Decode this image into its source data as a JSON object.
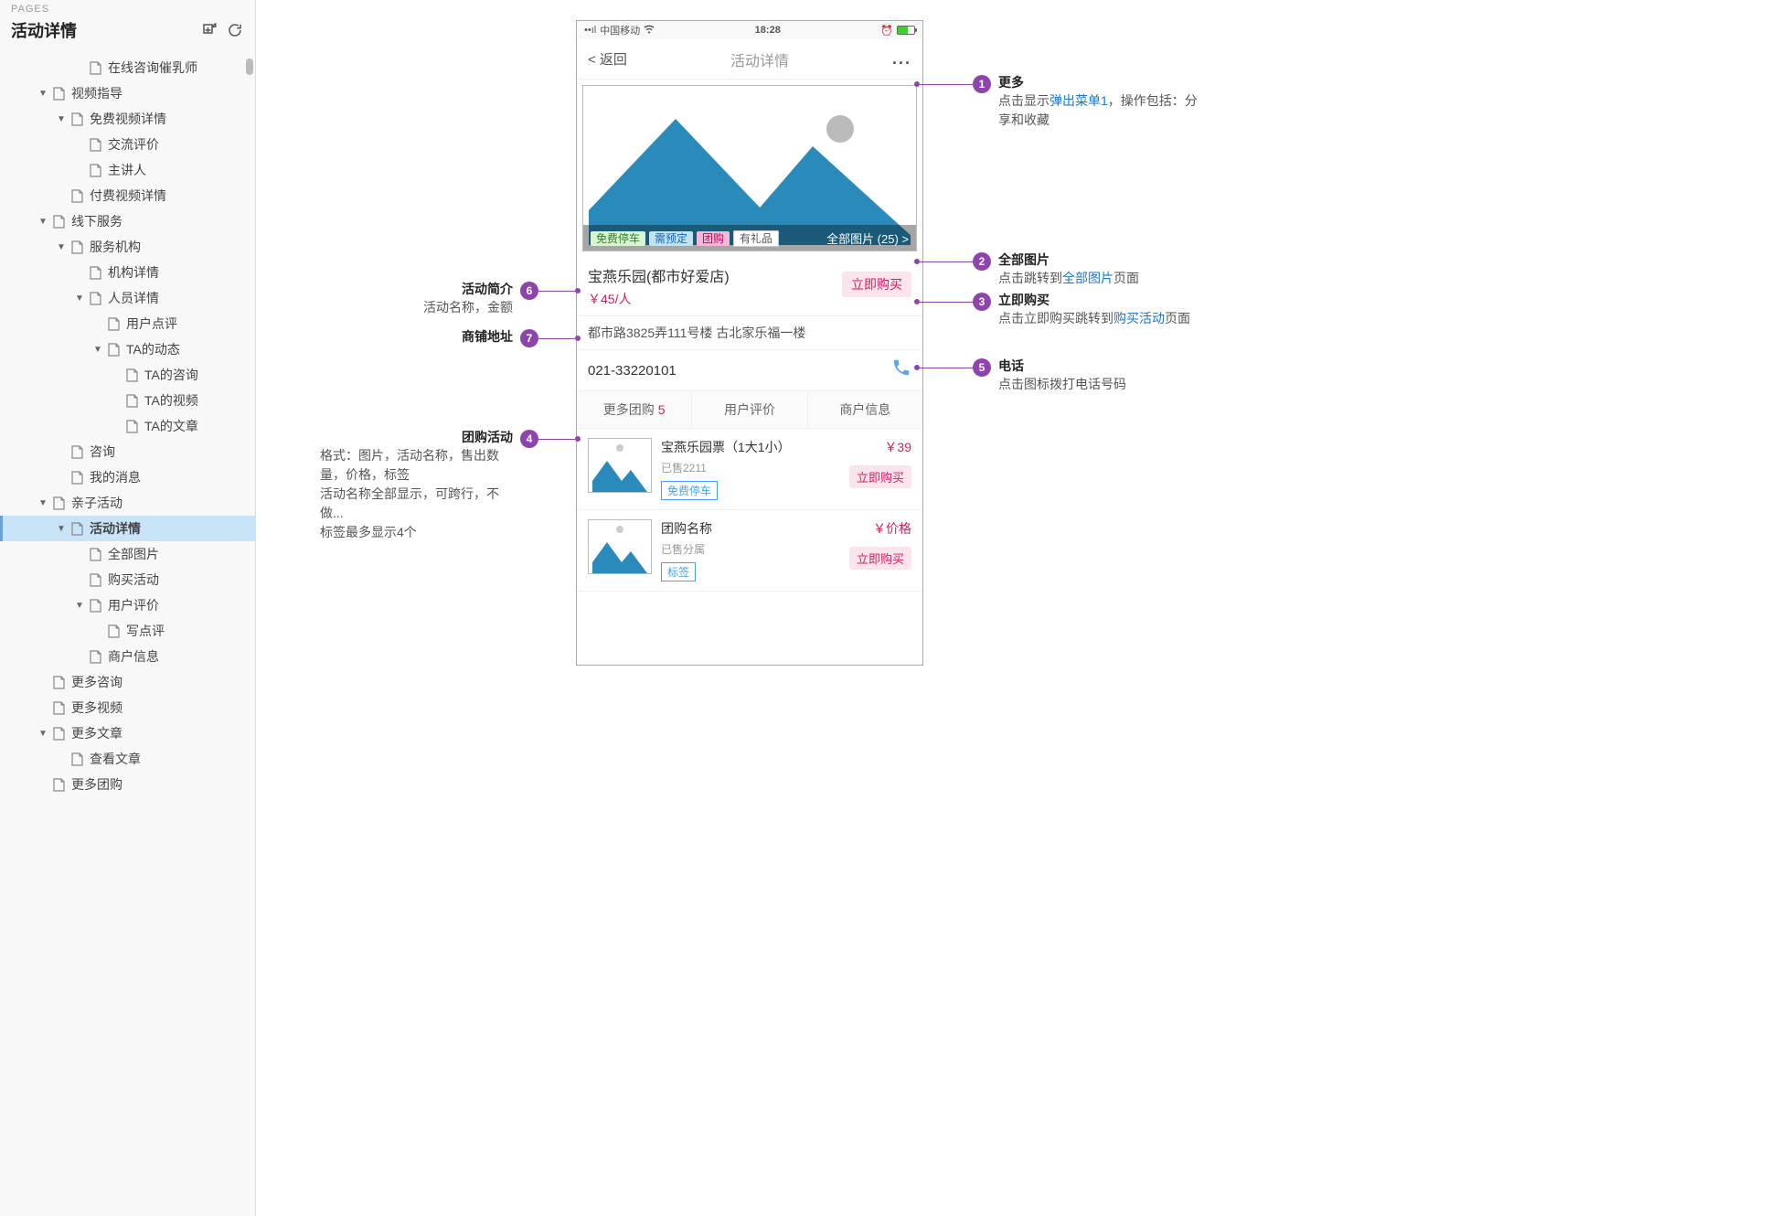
{
  "sidebar": {
    "label": "PAGES",
    "title": "活动详情",
    "tree": [
      {
        "label": "在线咨询催乳师",
        "indent": 4,
        "arrow": false
      },
      {
        "label": "视频指导",
        "indent": 2,
        "arrow": true
      },
      {
        "label": "免费视频详情",
        "indent": 3,
        "arrow": true
      },
      {
        "label": "交流评价",
        "indent": 4,
        "arrow": false
      },
      {
        "label": "主讲人",
        "indent": 4,
        "arrow": false
      },
      {
        "label": "付费视频详情",
        "indent": 3,
        "arrow": false
      },
      {
        "label": "线下服务",
        "indent": 2,
        "arrow": true
      },
      {
        "label": "服务机构",
        "indent": 3,
        "arrow": true
      },
      {
        "label": "机构详情",
        "indent": 4,
        "arrow": false
      },
      {
        "label": "人员详情",
        "indent": 4,
        "arrow": true
      },
      {
        "label": "用户点评",
        "indent": 5,
        "arrow": false
      },
      {
        "label": "TA的动态",
        "indent": 5,
        "arrow": true
      },
      {
        "label": "TA的咨询",
        "indent": 6,
        "arrow": false
      },
      {
        "label": "TA的视频",
        "indent": 6,
        "arrow": false
      },
      {
        "label": "TA的文章",
        "indent": 6,
        "arrow": false
      },
      {
        "label": "咨询",
        "indent": 3,
        "arrow": false
      },
      {
        "label": "我的消息",
        "indent": 3,
        "arrow": false
      },
      {
        "label": "亲子活动",
        "indent": 2,
        "arrow": true
      },
      {
        "label": "活动详情",
        "indent": 3,
        "arrow": true,
        "selected": true
      },
      {
        "label": "全部图片",
        "indent": 4,
        "arrow": false
      },
      {
        "label": "购买活动",
        "indent": 4,
        "arrow": false
      },
      {
        "label": "用户评价",
        "indent": 4,
        "arrow": true
      },
      {
        "label": "写点评",
        "indent": 5,
        "arrow": false
      },
      {
        "label": "商户信息",
        "indent": 4,
        "arrow": false
      },
      {
        "label": "更多咨询",
        "indent": 2,
        "arrow": false
      },
      {
        "label": "更多视频",
        "indent": 2,
        "arrow": false
      },
      {
        "label": "更多文章",
        "indent": 2,
        "arrow": true
      },
      {
        "label": "查看文章",
        "indent": 3,
        "arrow": false
      },
      {
        "label": "更多团购",
        "indent": 2,
        "arrow": false
      }
    ]
  },
  "phone": {
    "status": {
      "carrier": "中国移动",
      "time": "18:28"
    },
    "nav": {
      "back": "< 返回",
      "title": "活动详情"
    },
    "hero": {
      "tags": [
        {
          "text": "免费停车",
          "cls": "green"
        },
        {
          "text": "需预定",
          "cls": "blue"
        },
        {
          "text": "团购",
          "cls": "pink"
        },
        {
          "text": "有礼品",
          "cls": "white"
        }
      ],
      "photos": "全部图片 (25) >"
    },
    "info": {
      "title": "宝燕乐园(都市好爱店)",
      "price": "￥45/人",
      "buy": "立即购买",
      "address": "都市路3825弄111号楼 古北家乐福一楼",
      "phone": "021-33220101"
    },
    "tabs": [
      {
        "label": "更多团购",
        "count": "5"
      },
      {
        "label": "用户评价"
      },
      {
        "label": "商户信息"
      }
    ],
    "deals": [
      {
        "name": "宝燕乐园票（1大1小）",
        "sold": "已售2211",
        "tag": "免费停车",
        "price": "￥39",
        "buy": "立即购买"
      },
      {
        "name": "团购名称",
        "sold": "已售分属",
        "tag": "标签",
        "price": "￥价格",
        "buy": "立即购买"
      }
    ]
  },
  "annotations": {
    "a1": {
      "num": "1",
      "title": "更多",
      "desc_pre": "点击显示",
      "link": "弹出菜单1",
      "desc_post": "，操作包括：分享和收藏"
    },
    "a2": {
      "num": "2",
      "title": "全部图片",
      "desc_pre": "点击跳转到",
      "link": "全部图片",
      "desc_post": "页面"
    },
    "a3": {
      "num": "3",
      "title": "立即购买",
      "desc_pre": "点击立即购买跳转到",
      "link": "购买活动",
      "desc_post": "页面"
    },
    "a5": {
      "num": "5",
      "title": "电话",
      "desc": "点击图标拨打电话号码"
    },
    "a6": {
      "num": "6",
      "title": "活动简介",
      "desc": "活动名称，金额"
    },
    "a7": {
      "num": "7",
      "title": "商铺地址"
    },
    "a4": {
      "num": "4",
      "title": "团购活动",
      "line1": "格式：图片，活动名称，售出数量，价格，标签",
      "line2": "活动名称全部显示，可跨行，不做...",
      "line3": "标签最多显示4个"
    }
  }
}
